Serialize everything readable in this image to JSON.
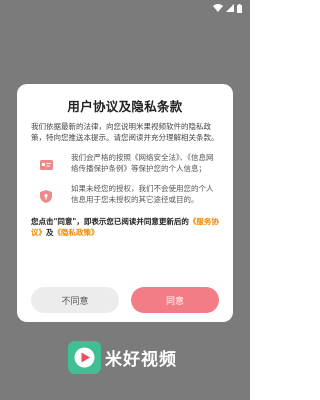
{
  "dialog": {
    "title": "用户协议及隐私条款",
    "intro": "我们依据最新的法律，向您说明米果视频软件的隐私政策，特向您推送本提示。请您阅读并充分理解相关条款。",
    "items": [
      {
        "text": "我们会严格的按照《网络安全法》、《信息网络传播保护条例》等保护您的个人信息；"
      },
      {
        "text": "如果未经您的授权，我们不会使用您的个人信息用于您未授权的其它途径或目的。"
      }
    ],
    "notice_prefix": "您点击\"同意\"，即表示您已阅读并同意更新后的",
    "service_link": "《服务协议》",
    "notice_and": "及",
    "privacy_link": "《隐私政策》",
    "disagree_label": "不同意",
    "agree_label": "同意"
  },
  "brand": {
    "name": "米好视频"
  },
  "colors": {
    "overlay": "#7b7b7b",
    "link": "#f08a00",
    "agree_button": "#f27d87",
    "icon_accent": "#f08a8a",
    "logo_green": "#40bf94"
  }
}
